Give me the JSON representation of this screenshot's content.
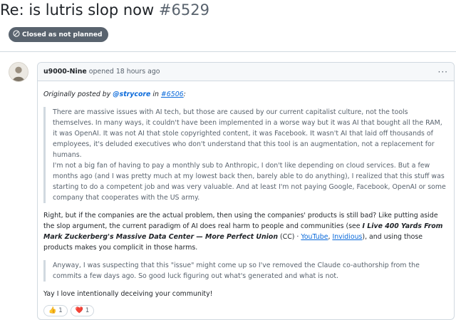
{
  "issue": {
    "title": "Re: is lutris slop now",
    "number": "#6529",
    "status_label": "Closed as not planned",
    "status_color": "#59636e"
  },
  "comment": {
    "author": "u9000-Nine",
    "action": "opened",
    "time": "18 hours ago",
    "menu_label": "···",
    "orig_prefix": "Originally posted by",
    "orig_user": "@strycore",
    "orig_in": "in",
    "orig_ref": "#6506",
    "orig_suffix": ":",
    "quote1": "There are massive issues with AI tech, but those are caused by our current capitalist culture, not the tools themselves. In many ways, it couldn't have been implemented in a worse way but it was AI that bought all the RAM, it was OpenAI. It was not AI that stole copyrighted content, it was Facebook. It wasn't AI that laid off thousands of employees, it's deluded executives who don't understand that this tool is an augmentation, not a replacement for humans.",
    "quote2": "I'm not a big fan of having to pay a monthly sub to Anthropic, I don't like depending on cloud services. But a few months ago (and I was pretty much at my lowest back then, barely able to do anything), I realized that this stuff was starting to do a competent job and was very valuable. And at least I'm not paying Google, Facebook, OpenAI or some company that cooperates with the US army.",
    "reply_a": "Right, but if the companies are the actual problem, then using the companies' products is still bad? Like putting aside the slop argument, the current paradigm of AI does real harm to people and communities (see",
    "reply_book": "I Live 400 Yards From Mark Zuckerberg's Massive Data Center — More Perfect Union",
    "reply_cc": "(CC) ·",
    "reply_link1": "YouTube",
    "reply_sep": ",",
    "reply_link2": "Invidious",
    "reply_b": "), and using those products makes you complicit in those harms.",
    "quote3": "Anyway, I was suspecting that this \"issue\" might come up so I've removed the Claude co-authorship from the commits a few days ago. So good luck figuring out what's generated and what is not.",
    "closing": "Yay I love intentionally deceiving your community!"
  },
  "reactions": [
    {
      "emoji": "👍",
      "count": "1",
      "icon": "thumbs-up-icon"
    },
    {
      "emoji": "❤️",
      "count": "1",
      "icon": "heart-icon"
    }
  ],
  "colors": {
    "link": "#0969da",
    "border": "#d1d9e0",
    "muted": "#59636e",
    "header_bg": "#f6f8fa"
  }
}
